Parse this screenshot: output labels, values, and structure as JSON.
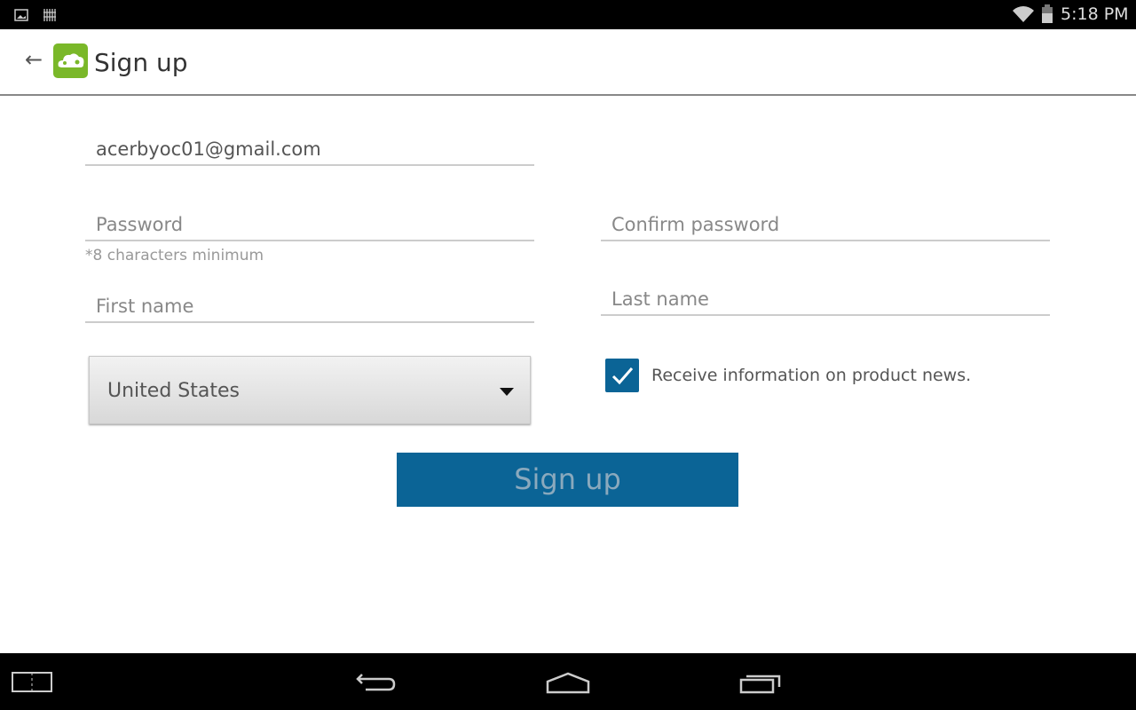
{
  "status_bar": {
    "time": "5:18 PM",
    "icons": [
      "image-icon",
      "barcode-icon",
      "wifi-icon",
      "battery-icon"
    ]
  },
  "app_bar": {
    "title": "Sign up",
    "logo": "cloud-logo",
    "logo_color": "#7ab829"
  },
  "form": {
    "email": {
      "value": "acerbyoc01@gmail.com"
    },
    "password": {
      "placeholder": "Password",
      "hint": "*8 characters minimum"
    },
    "confirm_password": {
      "placeholder": "Confirm password"
    },
    "first_name": {
      "placeholder": "First name"
    },
    "last_name": {
      "placeholder": "Last name"
    },
    "country": {
      "selected": "United States"
    },
    "newsletter": {
      "label": "Receive information on product news.",
      "checked": true
    },
    "submit_label": "Sign up",
    "accent": "#0b6496"
  }
}
